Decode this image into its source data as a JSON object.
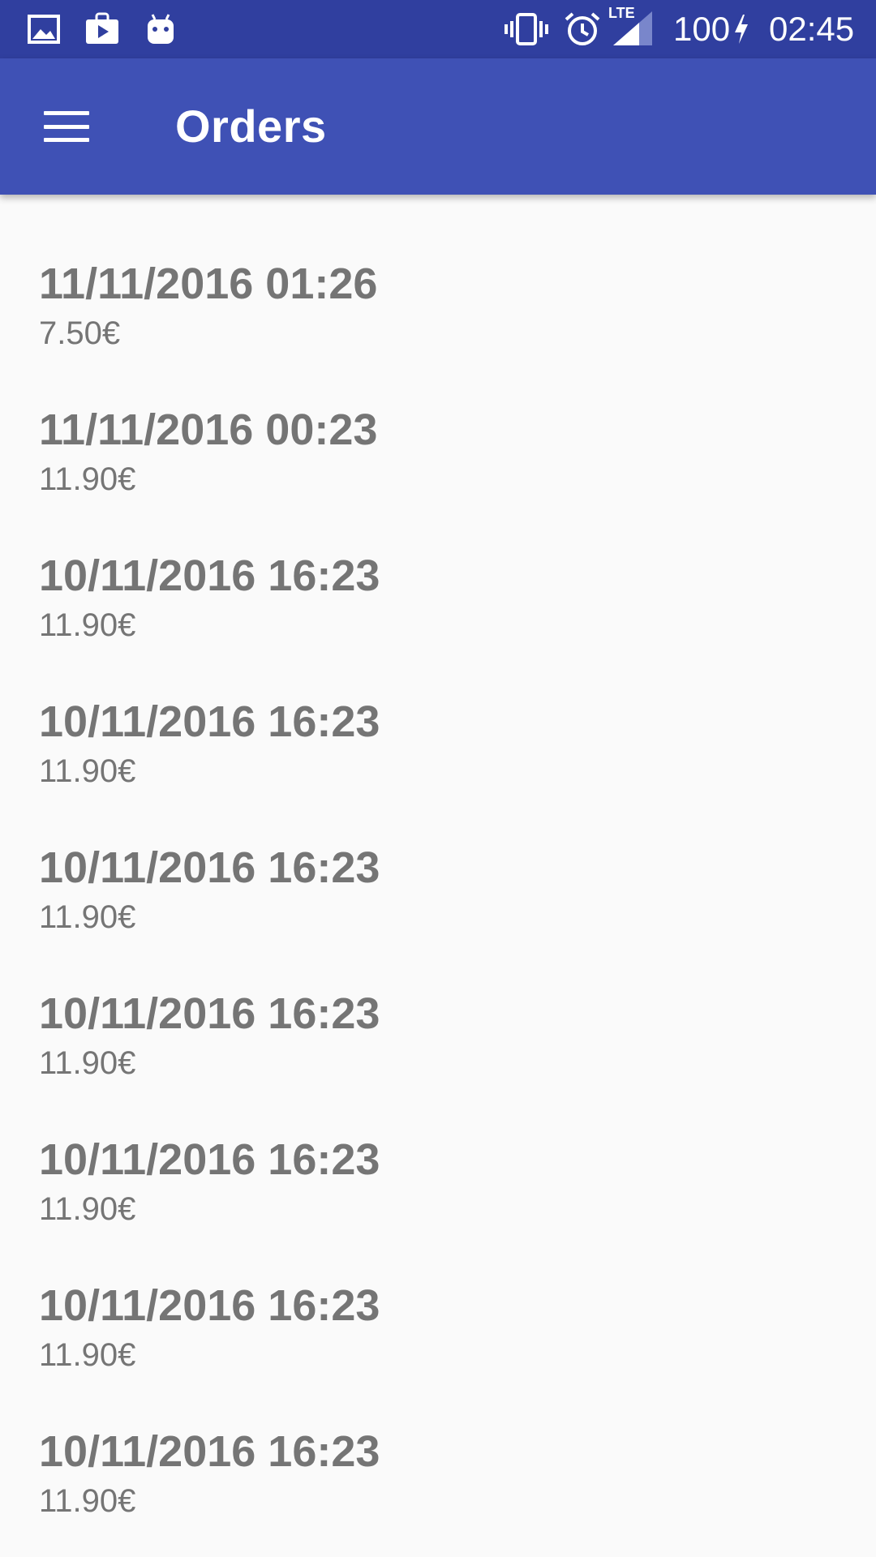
{
  "status_bar": {
    "icons_left": [
      "gallery-icon",
      "play-store-icon",
      "android-icon"
    ],
    "icons_right": [
      "vibrate-icon",
      "alarm-icon",
      "lte-signal-icon"
    ],
    "network_label": "LTE",
    "battery_level": "100",
    "time": "02:45"
  },
  "app_bar": {
    "title": "Orders",
    "menu_icon": "hamburger-menu-icon",
    "background_color": "#3f51b5",
    "status_color": "#303f9f"
  },
  "orders": [
    {
      "date": "11/11/2016 01:26",
      "price": "7.50€"
    },
    {
      "date": "11/11/2016 00:23",
      "price": "11.90€"
    },
    {
      "date": "10/11/2016 16:23",
      "price": "11.90€"
    },
    {
      "date": "10/11/2016 16:23",
      "price": "11.90€"
    },
    {
      "date": "10/11/2016 16:23",
      "price": "11.90€"
    },
    {
      "date": "10/11/2016 16:23",
      "price": "11.90€"
    },
    {
      "date": "10/11/2016 16:23",
      "price": "11.90€"
    },
    {
      "date": "10/11/2016 16:23",
      "price": "11.90€"
    },
    {
      "date": "10/11/2016 16:23",
      "price": "11.90€"
    }
  ],
  "colors": {
    "text_secondary": "#757575",
    "background": "#fafafa"
  }
}
